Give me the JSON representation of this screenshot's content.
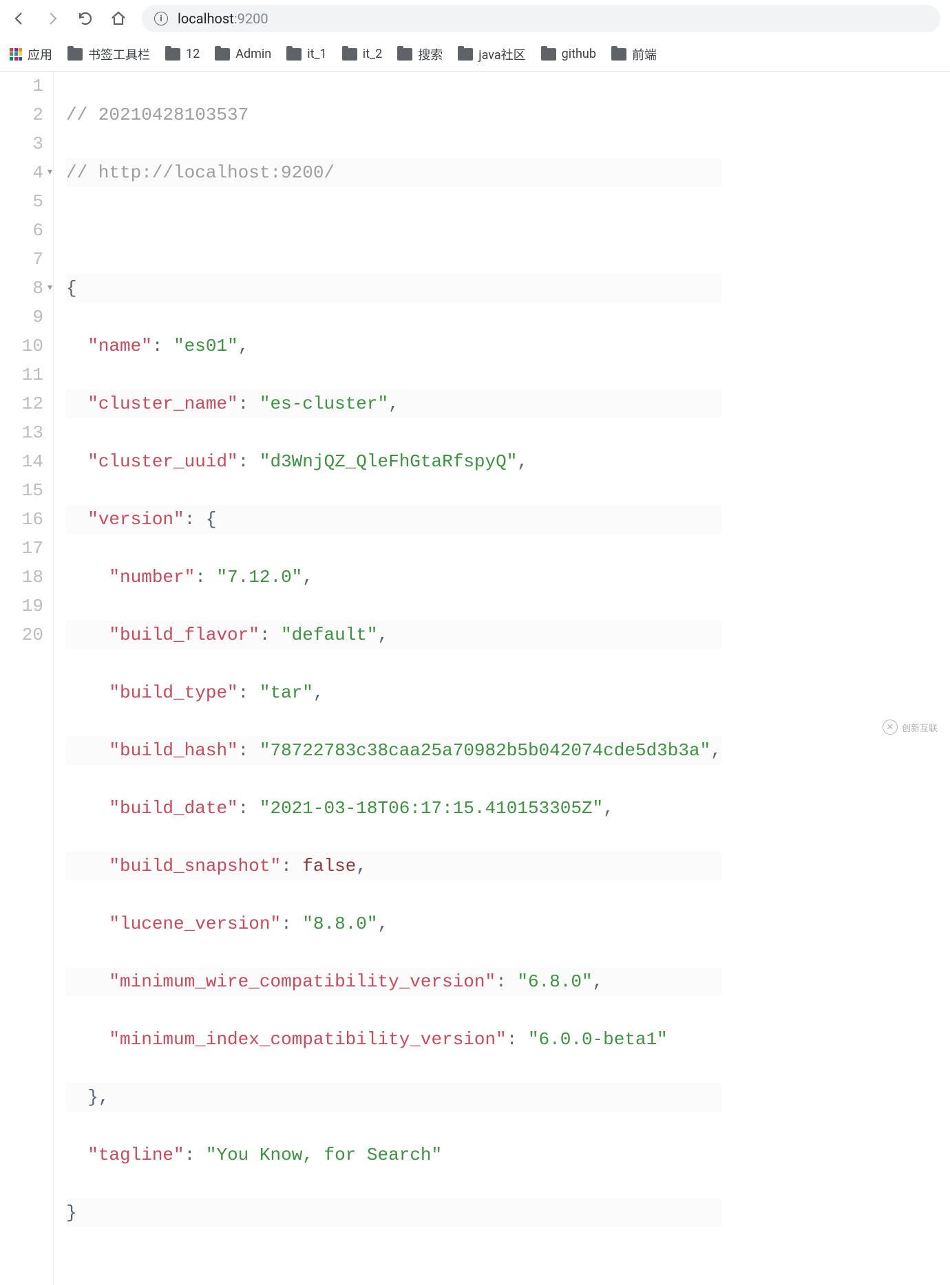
{
  "toolbar": {
    "url_host": "localhost",
    "url_port": ":9200"
  },
  "bookmarks": {
    "apps_label": "应用",
    "items": [
      "书签工具栏",
      "12",
      "Admin",
      "it_1",
      "it_2",
      "搜索",
      "java社区",
      "github",
      "前端"
    ]
  },
  "code": {
    "comment_ts": "// 20210428103537",
    "comment_url": "// http://localhost:9200/",
    "json": {
      "name_key": "\"name\"",
      "name_val": "\"es01\"",
      "cluster_name_key": "\"cluster_name\"",
      "cluster_name_val": "\"es-cluster\"",
      "cluster_uuid_key": "\"cluster_uuid\"",
      "cluster_uuid_val": "\"d3WnjQZ_QleFhGtaRfspyQ\"",
      "version_key": "\"version\"",
      "number_key": "\"number\"",
      "number_val": "\"7.12.0\"",
      "build_flavor_key": "\"build_flavor\"",
      "build_flavor_val": "\"default\"",
      "build_type_key": "\"build_type\"",
      "build_type_val": "\"tar\"",
      "build_hash_key": "\"build_hash\"",
      "build_hash_val": "\"78722783c38caa25a70982b5b042074cde5d3b3a\"",
      "build_date_key": "\"build_date\"",
      "build_date_val": "\"2021-03-18T06:17:15.410153305Z\"",
      "build_snapshot_key": "\"build_snapshot\"",
      "build_snapshot_val": "false",
      "lucene_version_key": "\"lucene_version\"",
      "lucene_version_val": "\"8.8.0\"",
      "min_wire_key": "\"minimum_wire_compatibility_version\"",
      "min_wire_val": "\"6.8.0\"",
      "min_index_key": "\"minimum_index_compatibility_version\"",
      "min_index_val": "\"6.0.0-beta1\"",
      "tagline_key": "\"tagline\"",
      "tagline_val": "\"You Know, for Search\""
    }
  },
  "line_numbers": [
    "1",
    "2",
    "3",
    "4",
    "5",
    "6",
    "7",
    "8",
    "9",
    "10",
    "11",
    "12",
    "13",
    "14",
    "15",
    "16",
    "17",
    "18",
    "19",
    "20"
  ],
  "watermark": {
    "text": "创新互联",
    "sub": ""
  }
}
